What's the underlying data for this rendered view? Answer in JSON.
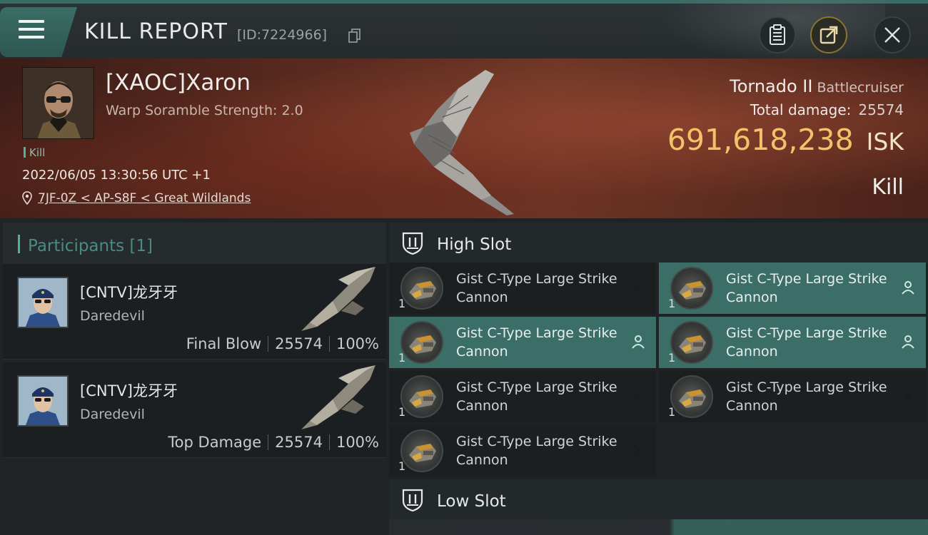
{
  "header": {
    "title": "KILL REPORT",
    "kill_id": "[ID:7224966]"
  },
  "victim": {
    "name": "[XAOC]Xaron",
    "subtitle": "Warp Soramble Strength: 2.0",
    "tag": "Kill",
    "datetime": "2022/06/05 13:30:56 UTC +1",
    "location": "7JF-0Z < AP-S8F < Great Wildlands",
    "ship_name": "Tornado II",
    "ship_class": "Battlecruiser",
    "total_damage_label": "Total damage:",
    "total_damage": "25574",
    "isk_value": "691,618,238",
    "isk_unit": "ISK",
    "result": "Kill"
  },
  "participants": {
    "header_label": "Participants",
    "header_count": "[1]",
    "rows": [
      {
        "name": "[CNTV]龙牙牙",
        "ship": "Daredevil",
        "role": "Final Blow",
        "damage": "25574",
        "percent": "100%"
      },
      {
        "name": "[CNTV]龙牙牙",
        "ship": "Daredevil",
        "role": "Top Damage",
        "damage": "25574",
        "percent": "100%"
      }
    ]
  },
  "high_slot": {
    "label": "High Slot",
    "modules": [
      {
        "name": "Gist C-Type Large Strike Cannon",
        "qty": "1",
        "status": "destroyed",
        "fitted": false
      },
      {
        "name": "Gist C-Type Large Strike Cannon",
        "qty": "1",
        "status": "dropped",
        "fitted": true
      },
      {
        "name": "Gist C-Type Large Strike Cannon",
        "qty": "1",
        "status": "dropped",
        "fitted": true
      },
      {
        "name": "Gist C-Type Large Strike Cannon",
        "qty": "1",
        "status": "dropped",
        "fitted": true
      },
      {
        "name": "Gist C-Type Large Strike Cannon",
        "qty": "1",
        "status": "destroyed",
        "fitted": false
      },
      {
        "name": "Gist C-Type Large Strike Cannon",
        "qty": "1",
        "status": "destroyed",
        "fitted": false
      },
      {
        "name": "Gist C-Type Large Strike Cannon",
        "qty": "1",
        "status": "destroyed",
        "fitted": false
      }
    ]
  },
  "low_slot": {
    "label": "Low Slot"
  },
  "colors": {
    "accent": "#3a6e66",
    "isk": "#f2c26a",
    "teal_text": "#4a8c82"
  }
}
